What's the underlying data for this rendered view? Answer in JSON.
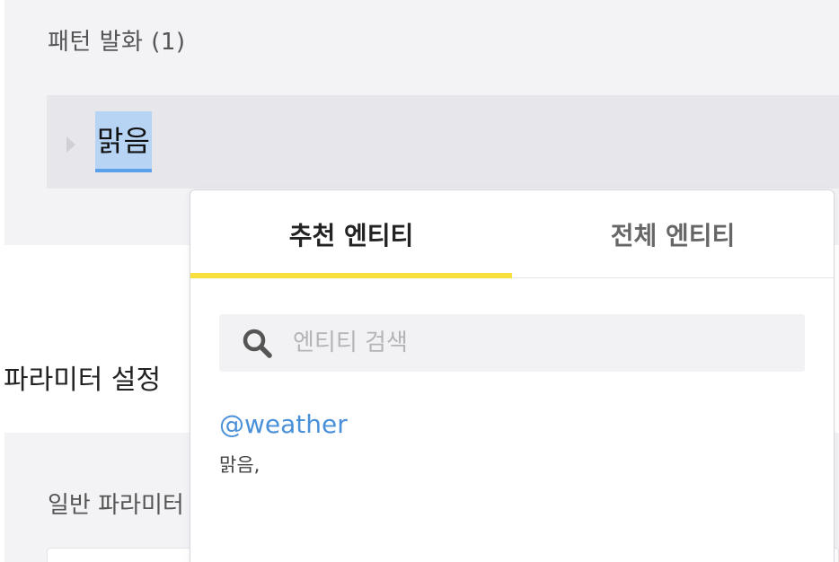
{
  "pattern_section": {
    "title": "패턴 발화 (1)",
    "utterance": "맑음"
  },
  "parameter_section": {
    "title": "파라미터 설정",
    "general_label": "일반 파라미터"
  },
  "entity_popover": {
    "tabs": [
      {
        "label": "추천 엔티티",
        "active": true
      },
      {
        "label": "전체 엔티티",
        "active": false
      }
    ],
    "search": {
      "placeholder": "엔티티 검색",
      "value": ""
    },
    "results": [
      {
        "name": "@weather",
        "values": "맑음,"
      }
    ]
  },
  "colors": {
    "accent_tab_indicator": "#f7e03d",
    "entity_link": "#4a90d9",
    "selection_highlight": "#b8d4f5",
    "selection_underline": "#5aa0ea"
  },
  "icons": {
    "caret": "caret-right-icon",
    "search": "search-icon"
  }
}
